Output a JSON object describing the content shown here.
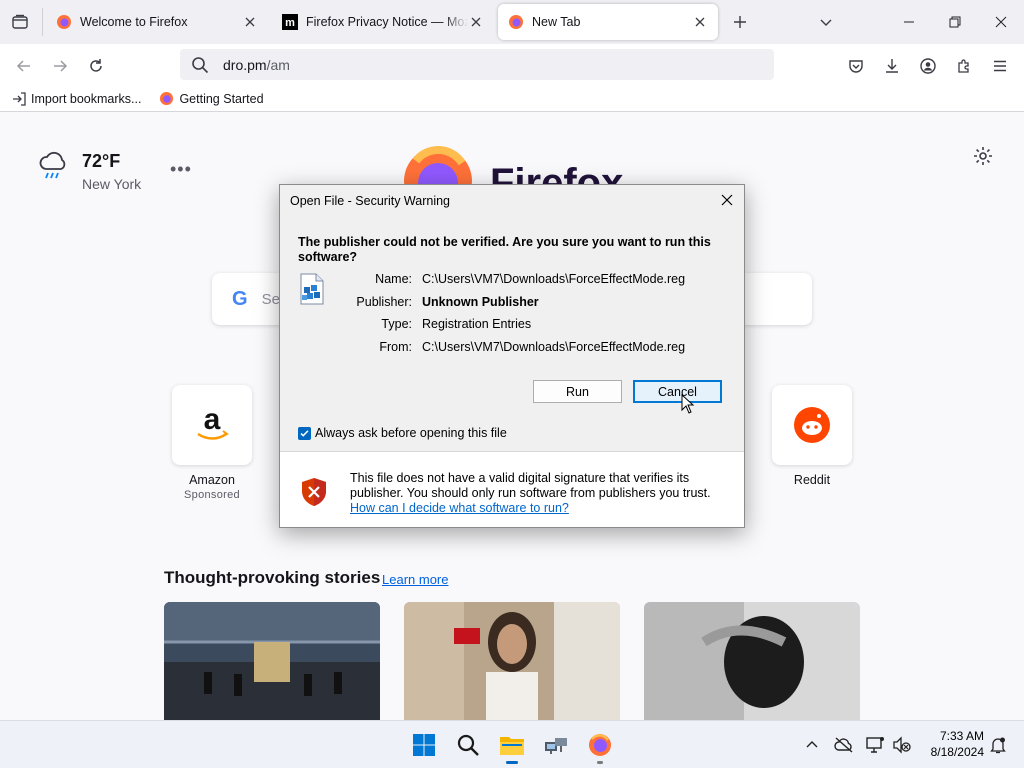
{
  "browser": {
    "tabs": [
      {
        "title": "Welcome to Firefox"
      },
      {
        "title": "Firefox Privacy Notice — Mozilla"
      },
      {
        "title": "New Tab"
      }
    ],
    "url_host": "dro.pm",
    "url_path": "/am",
    "bookmarks": [
      {
        "label": "Import bookmarks..."
      },
      {
        "label": "Getting Started"
      }
    ]
  },
  "newtab": {
    "weather": {
      "temp": "72°F",
      "city": "New York"
    },
    "logo_text": "Firefox",
    "search_placeholder": "Se",
    "search_logo": "G",
    "tiles": [
      {
        "label": "Amazon",
        "sub": "Sponsored"
      },
      {
        "label": "Reddit",
        "sub": ""
      }
    ],
    "stories": {
      "title": "Thought-provoking stories",
      "learn_more": "Learn more"
    }
  },
  "dialog": {
    "title": "Open File - Security Warning",
    "question": "The publisher could not be verified.  Are you sure you want to run this software?",
    "fields": [
      {
        "key": "Name:",
        "value": "C:\\Users\\VM7\\Downloads\\ForceEffectMode.reg",
        "bold": false
      },
      {
        "key": "Publisher:",
        "value": "Unknown Publisher",
        "bold": true
      },
      {
        "key": "Type:",
        "value": "Registration Entries",
        "bold": false
      },
      {
        "key": "From:",
        "value": "C:\\Users\\VM7\\Downloads\\ForceEffectMode.reg",
        "bold": false
      }
    ],
    "run_label": "Run",
    "cancel_label": "Cancel",
    "checkbox_label": "Always ask before opening this file",
    "checkbox_checked": true,
    "warning_text": "This file does not have a valid digital signature that verifies its publisher.  You should only run software from publishers you trust.",
    "warning_link": "How can I decide what software to run?"
  },
  "taskbar": {
    "time": "7:33 AM",
    "date": "8/18/2024"
  },
  "colors": {
    "accent": "#0067c0",
    "link": "#0066cc",
    "firefox_orange": "#ff7139",
    "shield_red": "#d83b01"
  }
}
